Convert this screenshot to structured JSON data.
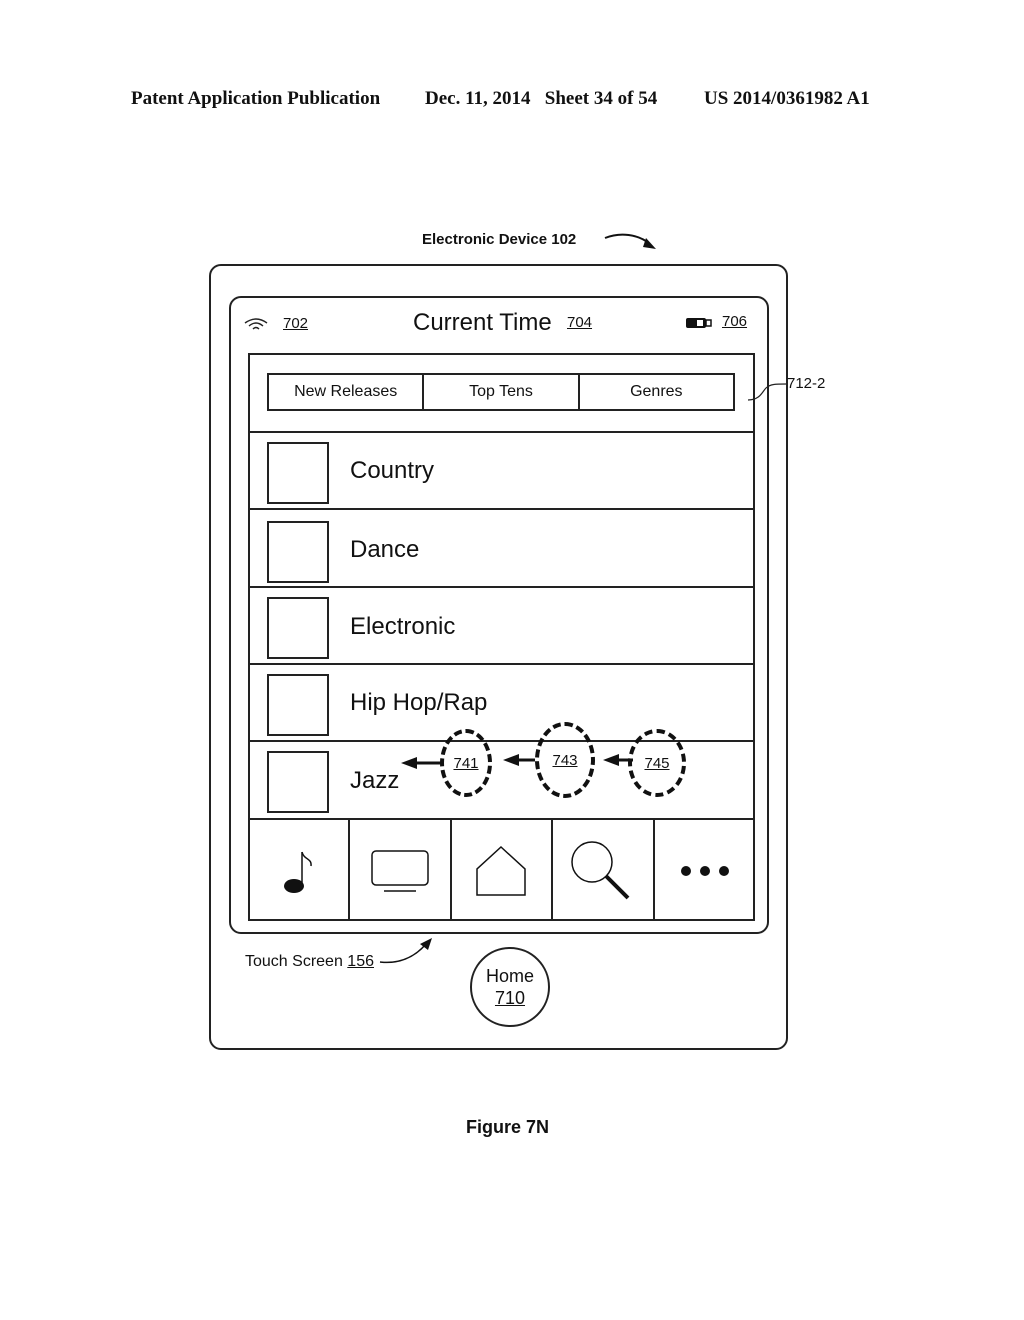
{
  "page_header": {
    "left": "Patent Application Publication",
    "center": "Dec. 11, 2014   Sheet 34 of 54",
    "right": "US 2014/0361982 A1"
  },
  "device_label": {
    "text": "Electronic Device",
    "ref": "102"
  },
  "status_bar": {
    "wifi_icon": "wifi-icon",
    "wifi_ref": "702",
    "title": "Current Time",
    "title_ref": "704",
    "battery_icon": "battery-icon",
    "battery_ref": "706"
  },
  "tabs_ref": "712-2",
  "tabs": [
    {
      "label": "New Releases"
    },
    {
      "label": "Top Tens"
    },
    {
      "label": "Genres"
    }
  ],
  "genres": [
    {
      "label": "Country"
    },
    {
      "label": "Dance"
    },
    {
      "label": "Electronic"
    },
    {
      "label": "Hip Hop/Rap"
    },
    {
      "label": "Jazz"
    }
  ],
  "touch_points": [
    {
      "ref": "741"
    },
    {
      "ref": "743"
    },
    {
      "ref": "745"
    }
  ],
  "nav_bar": [
    {
      "icon": "music-note-icon"
    },
    {
      "icon": "tv-icon"
    },
    {
      "icon": "home-icon"
    },
    {
      "icon": "search-icon"
    },
    {
      "icon": "more-icon"
    }
  ],
  "touch_screen_label": {
    "text": "Touch Screen",
    "ref": "156"
  },
  "home_button": {
    "label": "Home",
    "ref": "710"
  },
  "figure_caption": "Figure 7N"
}
